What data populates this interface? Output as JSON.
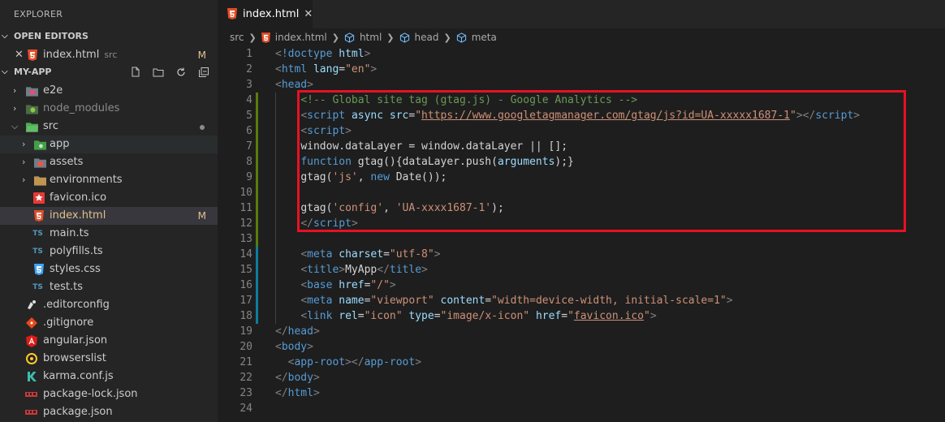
{
  "sidebar": {
    "title": "EXPLORER",
    "open_editors": {
      "header": "OPEN EDITORS",
      "items": [
        {
          "label": "index.html",
          "suffix": "src",
          "badge": "M"
        }
      ]
    },
    "project": {
      "header": "MY-APP",
      "items": [
        {
          "label": "e2e"
        },
        {
          "label": "node_modules"
        },
        {
          "label": "src"
        },
        {
          "label": "app"
        },
        {
          "label": "assets"
        },
        {
          "label": "environments"
        },
        {
          "label": "favicon.ico"
        },
        {
          "label": "index.html",
          "badge": "M"
        },
        {
          "label": "main.ts"
        },
        {
          "label": "polyfills.ts"
        },
        {
          "label": "styles.css"
        },
        {
          "label": "test.ts"
        },
        {
          "label": ".editorconfig"
        },
        {
          "label": ".gitignore"
        },
        {
          "label": "angular.json"
        },
        {
          "label": "browserslist"
        },
        {
          "label": "karma.conf.js"
        },
        {
          "label": "package-lock.json"
        },
        {
          "label": "package.json"
        }
      ]
    }
  },
  "tab": {
    "label": "index.html",
    "close": "✕"
  },
  "breadcrumb": [
    "src",
    "index.html",
    "html",
    "head",
    "meta"
  ],
  "editor": {
    "line_numbers": [
      "1",
      "2",
      "3",
      "4",
      "5",
      "6",
      "7",
      "8",
      "9",
      "10",
      "11",
      "12",
      "13",
      "14",
      "15",
      "16",
      "17",
      "18",
      "19",
      "20",
      "21",
      "22",
      "23",
      "24"
    ],
    "lines": [
      [
        [
          "t-punc",
          "<"
        ],
        [
          "t-tag",
          "!doctype"
        ],
        [
          "t-txt",
          " "
        ],
        [
          "t-attr",
          "html"
        ],
        [
          "t-punc",
          ">"
        ]
      ],
      [
        [
          "t-punc",
          "<"
        ],
        [
          "t-tag",
          "html"
        ],
        [
          "t-txt",
          " "
        ],
        [
          "t-attr",
          "lang"
        ],
        [
          "t-txt",
          "="
        ],
        [
          "t-str",
          "\"en\""
        ],
        [
          "t-punc",
          ">"
        ]
      ],
      [
        [
          "t-punc",
          "<"
        ],
        [
          "t-tag",
          "head"
        ],
        [
          "t-punc",
          ">"
        ]
      ],
      [
        [
          "t-txt",
          "    "
        ],
        [
          "t-cmt",
          "<!-- Global site tag (gtag.js) - Google Analytics -->"
        ]
      ],
      [
        [
          "t-txt",
          "    "
        ],
        [
          "t-punc",
          "<"
        ],
        [
          "t-tag",
          "script"
        ],
        [
          "t-txt",
          " "
        ],
        [
          "t-attr",
          "async"
        ],
        [
          "t-txt",
          " "
        ],
        [
          "t-attr",
          "src"
        ],
        [
          "t-txt",
          "="
        ],
        [
          "t-str",
          "\""
        ],
        [
          "t-str t-ul",
          "https://www.googletagmanager.com/gtag/js?id=UA-xxxxx1687-1"
        ],
        [
          "t-str",
          "\""
        ],
        [
          "t-punc",
          "></"
        ],
        [
          "t-tag",
          "script"
        ],
        [
          "t-punc",
          ">"
        ]
      ],
      [
        [
          "t-txt",
          "    "
        ],
        [
          "t-punc",
          "<"
        ],
        [
          "t-tag",
          "script"
        ],
        [
          "t-punc",
          ">"
        ]
      ],
      [
        [
          "t-txt",
          "    "
        ],
        [
          "t-txt",
          "window.dataLayer = window.dataLayer || [];"
        ]
      ],
      [
        [
          "t-txt",
          "    "
        ],
        [
          "t-kw",
          "function"
        ],
        [
          "t-txt",
          " gtag(){dataLayer.push("
        ],
        [
          "t-var",
          "arguments"
        ],
        [
          "t-txt",
          ");}"
        ]
      ],
      [
        [
          "t-txt",
          "    "
        ],
        [
          "t-txt",
          "gtag("
        ],
        [
          "t-str",
          "'js'"
        ],
        [
          "t-txt",
          ", "
        ],
        [
          "t-kw",
          "new"
        ],
        [
          "t-txt",
          " Date());"
        ]
      ],
      [
        [
          "t-txt",
          ""
        ]
      ],
      [
        [
          "t-txt",
          "    "
        ],
        [
          "t-txt",
          "gtag("
        ],
        [
          "t-str",
          "'config'"
        ],
        [
          "t-txt",
          ", "
        ],
        [
          "t-str",
          "'UA-xxxx1687-1'"
        ],
        [
          "t-txt",
          ");"
        ]
      ],
      [
        [
          "t-txt",
          "    "
        ],
        [
          "t-punc",
          "</"
        ],
        [
          "t-tag",
          "script"
        ],
        [
          "t-punc",
          ">"
        ]
      ],
      [
        [
          "t-txt",
          ""
        ]
      ],
      [
        [
          "t-txt",
          "    "
        ],
        [
          "t-punc",
          "<"
        ],
        [
          "t-tag",
          "meta"
        ],
        [
          "t-txt",
          " "
        ],
        [
          "t-attr",
          "charset"
        ],
        [
          "t-txt",
          "="
        ],
        [
          "t-str",
          "\"utf-8\""
        ],
        [
          "t-punc",
          ">"
        ]
      ],
      [
        [
          "t-txt",
          "    "
        ],
        [
          "t-punc",
          "<"
        ],
        [
          "t-tag",
          "title"
        ],
        [
          "t-punc",
          ">"
        ],
        [
          "t-txt",
          "MyApp"
        ],
        [
          "t-punc",
          "</"
        ],
        [
          "t-tag",
          "title"
        ],
        [
          "t-punc",
          ">"
        ]
      ],
      [
        [
          "t-txt",
          "    "
        ],
        [
          "t-punc",
          "<"
        ],
        [
          "t-tag",
          "base"
        ],
        [
          "t-txt",
          " "
        ],
        [
          "t-attr",
          "href"
        ],
        [
          "t-txt",
          "="
        ],
        [
          "t-str",
          "\"/\""
        ],
        [
          "t-punc",
          ">"
        ]
      ],
      [
        [
          "t-txt",
          "    "
        ],
        [
          "t-punc",
          "<"
        ],
        [
          "t-tag",
          "meta"
        ],
        [
          "t-txt",
          " "
        ],
        [
          "t-attr",
          "name"
        ],
        [
          "t-txt",
          "="
        ],
        [
          "t-str",
          "\"viewport\""
        ],
        [
          "t-txt",
          " "
        ],
        [
          "t-attr",
          "content"
        ],
        [
          "t-txt",
          "="
        ],
        [
          "t-str",
          "\"width=device-width, initial-scale=1\""
        ],
        [
          "t-punc",
          ">"
        ]
      ],
      [
        [
          "t-txt",
          "    "
        ],
        [
          "t-punc",
          "<"
        ],
        [
          "t-tag",
          "link"
        ],
        [
          "t-txt",
          " "
        ],
        [
          "t-attr",
          "rel"
        ],
        [
          "t-txt",
          "="
        ],
        [
          "t-str",
          "\"icon\""
        ],
        [
          "t-txt",
          " "
        ],
        [
          "t-attr",
          "type"
        ],
        [
          "t-txt",
          "="
        ],
        [
          "t-str",
          "\"image/x-icon\""
        ],
        [
          "t-txt",
          " "
        ],
        [
          "t-attr",
          "href"
        ],
        [
          "t-txt",
          "="
        ],
        [
          "t-str",
          "\""
        ],
        [
          "t-str t-ul",
          "favicon.ico"
        ],
        [
          "t-str",
          "\""
        ],
        [
          "t-punc",
          ">"
        ]
      ],
      [
        [
          "t-punc",
          "</"
        ],
        [
          "t-tag",
          "head"
        ],
        [
          "t-punc",
          ">"
        ]
      ],
      [
        [
          "t-punc",
          "<"
        ],
        [
          "t-tag",
          "body"
        ],
        [
          "t-punc",
          ">"
        ]
      ],
      [
        [
          "t-txt",
          "  "
        ],
        [
          "t-punc",
          "<"
        ],
        [
          "t-tag",
          "app-root"
        ],
        [
          "t-punc",
          "></"
        ],
        [
          "t-tag",
          "app-root"
        ],
        [
          "t-punc",
          ">"
        ]
      ],
      [
        [
          "t-punc",
          "</"
        ],
        [
          "t-tag",
          "body"
        ],
        [
          "t-punc",
          ">"
        ]
      ],
      [
        [
          "t-punc",
          "</"
        ],
        [
          "t-tag",
          "html"
        ],
        [
          "t-punc",
          ">"
        ]
      ],
      [
        [
          "t-txt",
          ""
        ]
      ]
    ]
  },
  "colors": {
    "modified": "#e2c08d",
    "highlight_border": "#e81123",
    "added_bar": "#587c0c",
    "modified_bar": "#0c7d9d"
  }
}
